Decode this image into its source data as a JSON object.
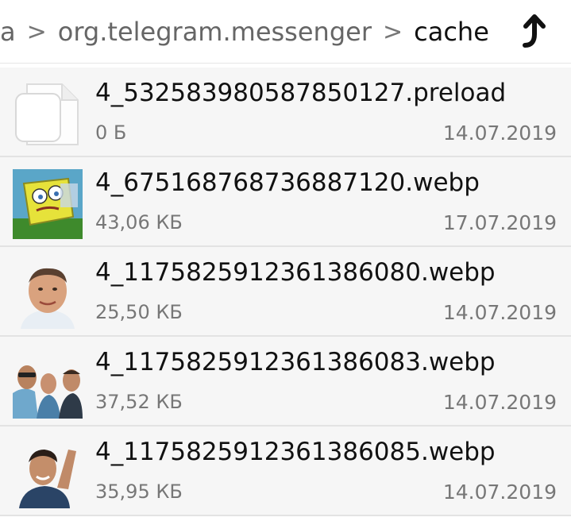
{
  "breadcrumb": {
    "items": [
      "a",
      "org.telegram.messenger",
      "cache"
    ],
    "separator": ">"
  },
  "icons": {
    "up": "up-arrow-icon",
    "file": "blank-file-icon"
  },
  "files": [
    {
      "name": "4_532583980587850127.preload",
      "size": "0 Б",
      "date": "14.07.2019",
      "thumb": "blank-file-icon"
    },
    {
      "name": "4_675168768736887120.webp",
      "size": "43,06 КБ",
      "date": "17.07.2019",
      "thumb": "sticker-thumbnail"
    },
    {
      "name": "4_1175825912361386080.webp",
      "size": "25,50 КБ",
      "date": "14.07.2019",
      "thumb": "photo-thumbnail"
    },
    {
      "name": "4_1175825912361386083.webp",
      "size": "37,52 КБ",
      "date": "14.07.2019",
      "thumb": "photo-thumbnail"
    },
    {
      "name": "4_1175825912361386085.webp",
      "size": "35,95 КБ",
      "date": "14.07.2019",
      "thumb": "photo-thumbnail"
    }
  ],
  "colors": {
    "row_bg": "#f6f6f6",
    "divider": "#e3e3e3",
    "text_primary": "#111111",
    "text_secondary": "#777777"
  }
}
